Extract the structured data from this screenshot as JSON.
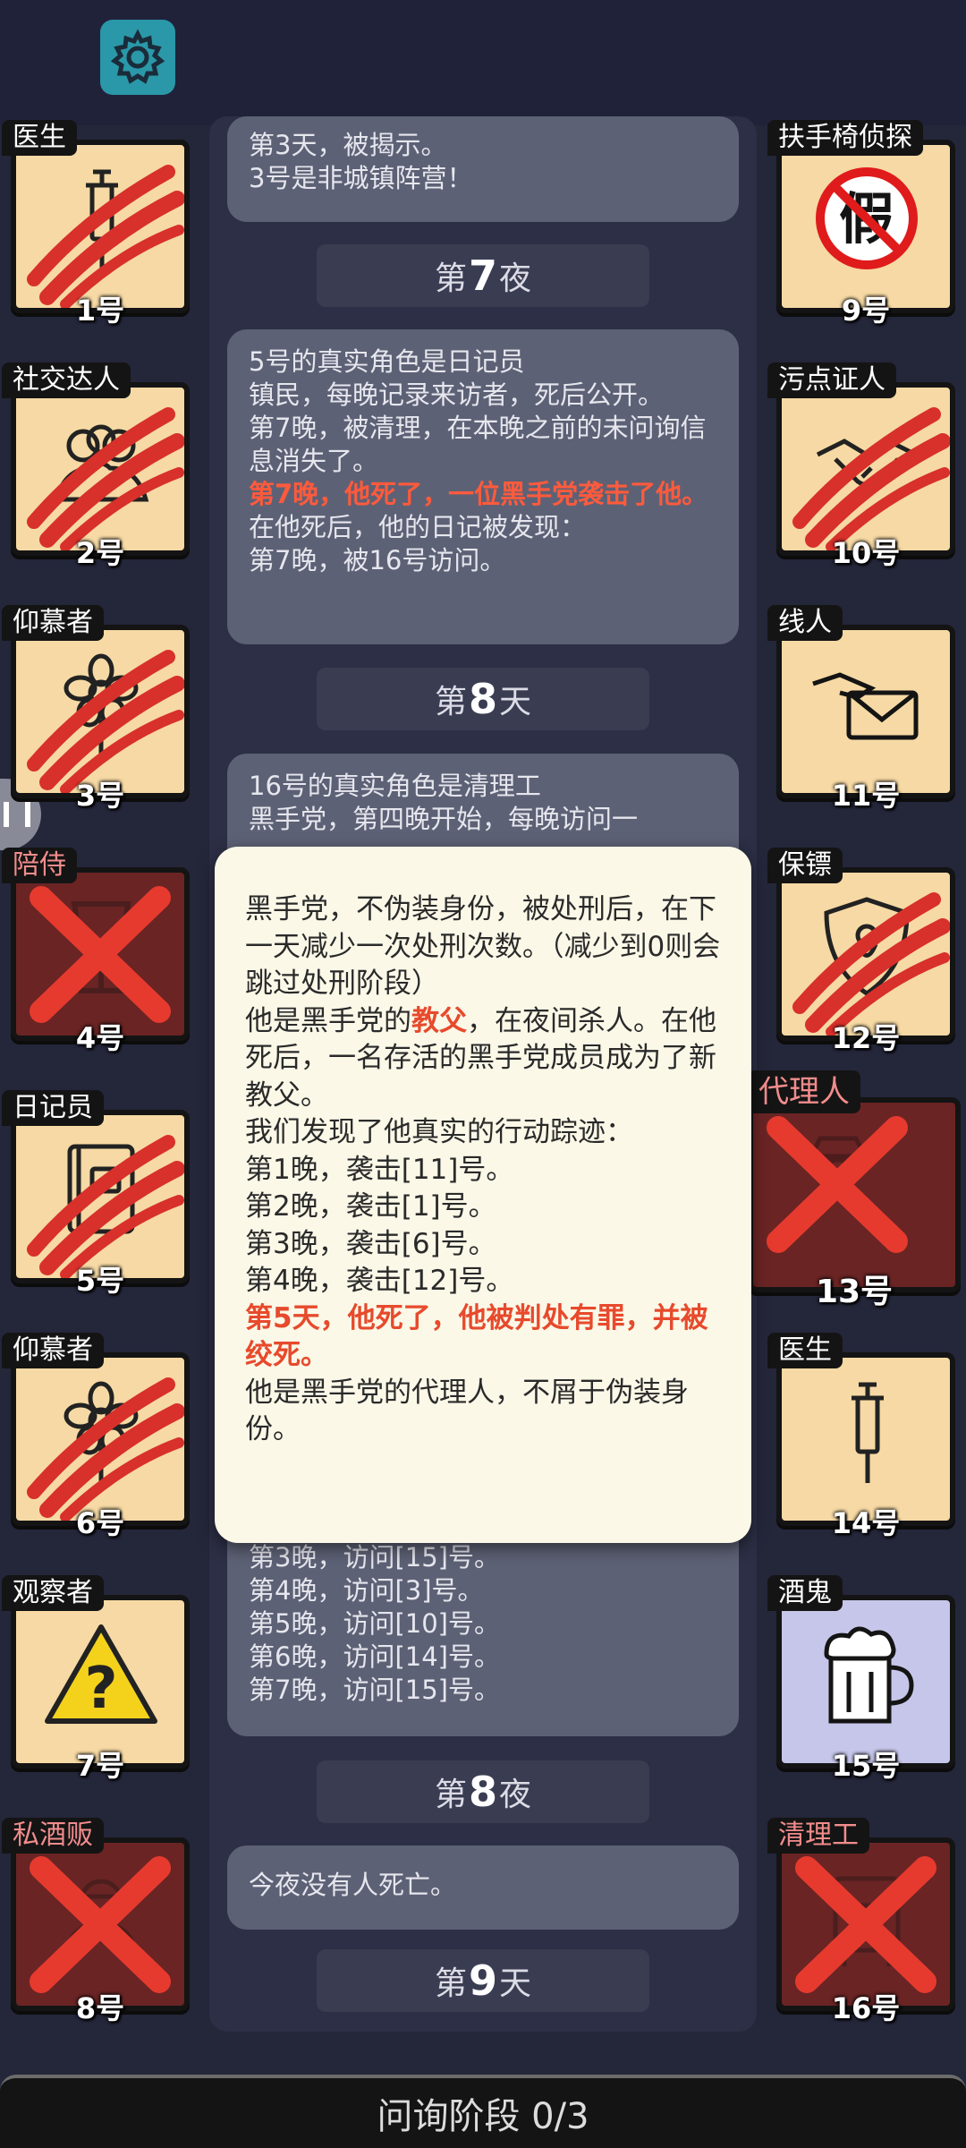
{
  "settings": {
    "icon": "gear-icon"
  },
  "log": {
    "card1": [
      "第3天，被揭示。",
      "3号是非城镇阵营！"
    ],
    "header_night7": {
      "prefix": "第",
      "num": "7",
      "suffix": "夜"
    },
    "card2": {
      "line1": "5号的真实角色是日记员",
      "line2": "镇民，每晚记录来访者，死后公开。",
      "line3": "第7晚，被清理，在本晚之前的未问询信息消失了。",
      "red": "第7晚，他死了，一位黑手党袭击了他。",
      "line5": "在他死后，他的日记被发现：",
      "line6": "第7晚，被16号访问。"
    },
    "header_day8": {
      "prefix": "第",
      "num": "8",
      "suffix": "天"
    },
    "card3": {
      "line1": "16号的真实角色是清理工",
      "line2": "黑手党，第四晚开始，每晚访问一",
      "visits": [
        "第3晚，访问[15]号。",
        "第4晚，访问[3]号。",
        "第5晚，访问[10]号。",
        "第6晚，访问[14]号。",
        "第7晚，访问[15]号。"
      ]
    },
    "header_night8": {
      "prefix": "第",
      "num": "8",
      "suffix": "夜"
    },
    "card4": "今夜没有人死亡。",
    "header_day9": {
      "prefix": "第",
      "num": "9",
      "suffix": "天"
    }
  },
  "popup": {
    "p1": "黑手党，不伪装身份，被处刑后，在下一天减少一次处刑次数。（减少到0则会跳过处刑阶段）",
    "p2_a": "他是黑手党的",
    "p2_red": "教父",
    "p2_b": "，在夜间杀人。在他死后，一名存活的黑手党成员成为了新教父。",
    "p3": "我们发现了他真实的行动踪迹：",
    "actions": [
      "第1晚，袭击[11]号。",
      "第2晚，袭击[1]号。",
      "第3晚，袭击[6]号。",
      "第4晚，袭击[12]号。"
    ],
    "death": "第5天，他死了，他被判处有罪，并被绞死。",
    "p5": "他是黑手党的代理人，不屑于伪装身份。"
  },
  "players_left": [
    {
      "role": "医生",
      "num": "1号",
      "icon": "syringe-icon",
      "state": "clawed"
    },
    {
      "role": "社交达人",
      "num": "2号",
      "icon": "people-icon",
      "state": "clawed"
    },
    {
      "role": "仰慕者",
      "num": "3号",
      "icon": "flower-icon",
      "state": "clawed"
    },
    {
      "role": "陪侍",
      "num": "4号",
      "icon": "wine-glass-icon",
      "state": "dead"
    },
    {
      "role": "日记员",
      "num": "5号",
      "icon": "diary-icon",
      "state": "clawed"
    },
    {
      "role": "仰慕者",
      "num": "6号",
      "icon": "flower-icon",
      "state": "clawed"
    },
    {
      "role": "观察者",
      "num": "7号",
      "icon": "warning-question-icon",
      "state": "normal"
    },
    {
      "role": "私酒贩",
      "num": "8号",
      "icon": "bootlegger-icon",
      "state": "dead"
    }
  ],
  "players_right": [
    {
      "role": "扶手椅侦探",
      "num": "9号",
      "icon": "fake-stamp-icon",
      "state": "normal"
    },
    {
      "role": "污点证人",
      "num": "10号",
      "icon": "handshake-icon",
      "state": "clawed"
    },
    {
      "role": "线人",
      "num": "11号",
      "icon": "envelope-hand-icon",
      "state": "normal"
    },
    {
      "role": "保镖",
      "num": "12号",
      "icon": "shield-icon",
      "state": "clawed"
    },
    {
      "role": "代理人",
      "num": "13号",
      "icon": "mobster-icon",
      "state": "dead"
    },
    {
      "role": "医生",
      "num": "14号",
      "icon": "syringe-icon",
      "state": "normal"
    },
    {
      "role": "酒鬼",
      "num": "15号",
      "icon": "beer-mug-icon",
      "state": "normal"
    },
    {
      "role": "清理工",
      "num": "16号",
      "icon": "cleaner-icon",
      "state": "dead"
    }
  ],
  "colors": {
    "claw": "#d8302a",
    "cross": "#e63a2e",
    "tile": "#f6d9a4",
    "dead_tile": "#6a2424",
    "drunk_tile": "#c6c6ea"
  },
  "bottom": {
    "phase_label": "问询阶段 0/3"
  }
}
